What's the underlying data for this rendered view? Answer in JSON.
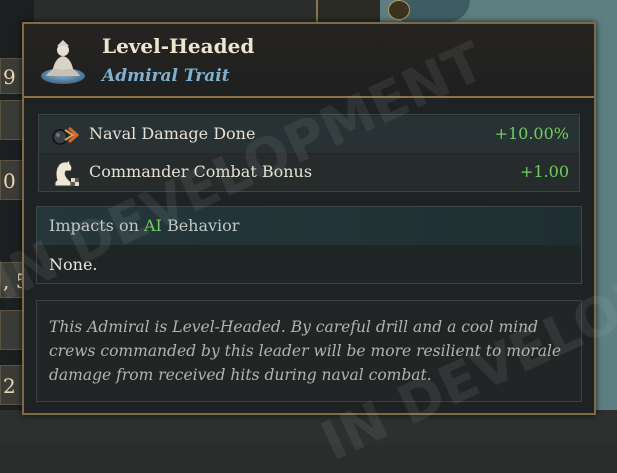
{
  "background": {
    "left_tiles": [
      "9",
      "0",
      ", 5",
      "2"
    ]
  },
  "tooltip": {
    "title": "Level-Headed",
    "subtitle": "Admiral Trait",
    "portrait_icon": "admiral-portrait-icon",
    "effects": [
      {
        "icon": "cannonball-icon",
        "label": "Naval Damage Done",
        "value": "+10.00%"
      },
      {
        "icon": "chess-knight-icon",
        "label": "Commander Combat Bonus",
        "value": "+1.00"
      }
    ],
    "ai_section": {
      "prefix": "Impacts on ",
      "highlight": "AI",
      "suffix": " Behavior",
      "value": "None."
    },
    "description": "This Admiral is Level-Headed. By careful drill and a cool mind crews commanded by this leader will be more resilient to morale damage from received hits during naval combat."
  },
  "watermark": {
    "text1": "IN DEVELOPMENT",
    "text2": "IN DEVELOPMENT"
  },
  "colors": {
    "positive": "#6fce5e",
    "subtitle": "#7fb0cf",
    "border": "#7e6a45"
  }
}
